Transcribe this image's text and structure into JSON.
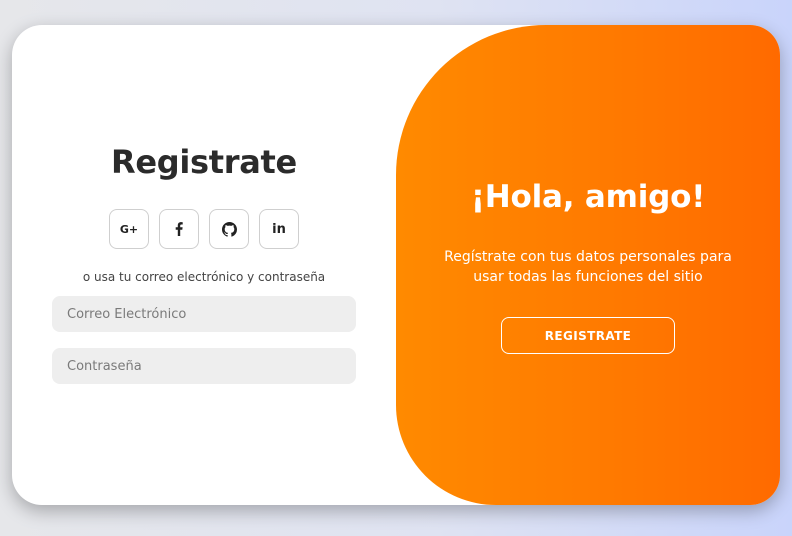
{
  "form": {
    "title": "Registrate",
    "socials": [
      {
        "label": "G+",
        "icon": "google-plus-icon"
      },
      {
        "label": "",
        "icon": "facebook-icon"
      },
      {
        "label": "",
        "icon": "github-icon"
      },
      {
        "label": "in",
        "icon": "linkedin-icon"
      }
    ],
    "helper_text": "o usa tu correo electrónico y contraseña",
    "email": {
      "placeholder": "Correo Electrónico",
      "value": ""
    },
    "password": {
      "placeholder": "Contraseña",
      "value": ""
    }
  },
  "toggle": {
    "title": "¡Hola, amigo!",
    "text": "Regístrate con tus datos personales para usar todas las funciones del sitio",
    "button_label": "REGISTRATE"
  },
  "colors": {
    "accent_start": "#ff8a00",
    "accent_end": "#ff6a00",
    "card_bg": "#ffffff",
    "input_bg": "#eeeeee",
    "heading": "#2b2b2b"
  }
}
